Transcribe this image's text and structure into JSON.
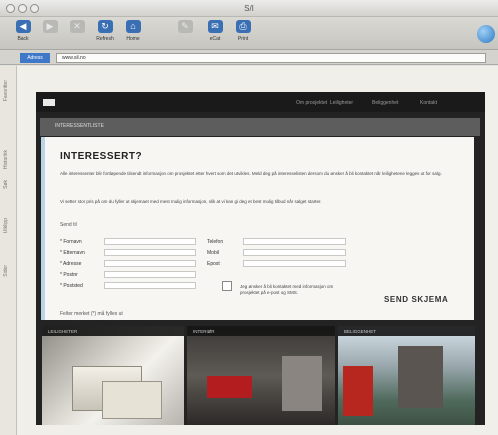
{
  "window": {
    "title": "S/I"
  },
  "toolbar": {
    "buttons": [
      {
        "name": "back-button",
        "icon": "back-arrow-icon",
        "label": "Back",
        "active": true
      },
      {
        "name": "forward-button",
        "icon": "forward-arrow-icon",
        "label": "",
        "active": false
      },
      {
        "name": "stop-button",
        "icon": "stop-icon",
        "label": "",
        "active": false
      },
      {
        "name": "refresh-button",
        "icon": "refresh-icon",
        "label": "Refresh",
        "active": true
      },
      {
        "name": "home-button",
        "icon": "home-icon",
        "label": "Home",
        "active": true
      },
      {
        "name": "autofill-button",
        "icon": "autofill-icon",
        "label": "",
        "active": false
      },
      {
        "name": "mail-button",
        "icon": "mail-icon",
        "label": "eCat",
        "active": true
      },
      {
        "name": "print-button",
        "icon": "print-icon",
        "label": "Print",
        "active": true
      }
    ]
  },
  "address": {
    "label": "Adress",
    "value": "www.sil.no"
  },
  "sidebar": {
    "labels": [
      "Favoritter",
      "Historikk",
      "Søk",
      "Utklipp",
      "Sider"
    ]
  },
  "site": {
    "nav": [
      "Om prosjektet",
      "Leiligheter",
      "Beliggenhet",
      "Kontakt"
    ],
    "section_title": "INTERESSENTLISTE",
    "form": {
      "title": "INTERESSERT?",
      "intro": "Alle interessenter blir fortløpende tilsendt informasjon om prosjektet etter hvert som det utvikles. Meld deg på interesselisten dersom du ønsker å bli kontaktet når leilighetene legges ut for salg.",
      "info": "Vi setter stor pris på om du fyller ut skjemaet med mest mulig informasjon, slik at vi kan gi deg et best mulig tilbud når salget starter.",
      "send_to": "Send til",
      "left_fields": [
        "* Fornavn",
        "* Etternavn",
        "* Adresse",
        "* Postnr",
        "* Poststed"
      ],
      "right_fields": [
        "Telefon",
        "Mobil",
        "Epost"
      ],
      "consent": "Jeg ønsker å bli kontaktet med informasjon om prosjektet på e-post og SMS.",
      "submit": "SEND SKJEMA",
      "footnote": "Felter merket (*) må fylles ut"
    },
    "thumbs": [
      "LEILIGHETER",
      "INTERIØR",
      "BELIGGENHET"
    ],
    "colors": {
      "accent": "#3f78c9",
      "dark": "#232323",
      "panel": "#f7f6f3"
    }
  }
}
